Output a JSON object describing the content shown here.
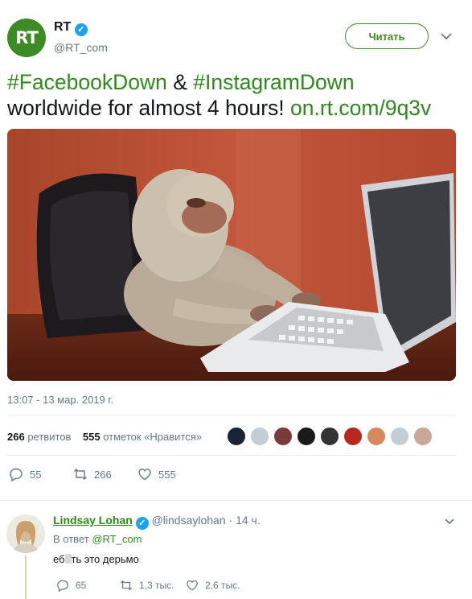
{
  "tweet": {
    "author_name": "RT",
    "author_handle": "@RT_com",
    "avatar_text": "RT",
    "follow_label": "Читать",
    "hashtag1": "#FacebookDown",
    "amp": " & ",
    "hashtag2": "#InstagramDown",
    "text_line2": "worldwide for almost 4 hours! ",
    "link": "on.rt.com/9q3v",
    "timestamp": "13:07 - 13 мар. 2019 г.",
    "retweets_count": "266",
    "retweets_label": "ретвитов",
    "likes_count": "555",
    "likes_label": "отметок «Нравится»",
    "replies_action": "55",
    "retweets_action": "266",
    "likes_action": "555"
  },
  "reply": {
    "author_name": "Lindsay Lohan",
    "author_handle": "@lindsaylohan",
    "time": "· 14 ч.",
    "reply_prefix": "В ответ ",
    "reply_to": "@RT_com",
    "text": "еб",
    "text_rest": "ть это дерьмо",
    "replies": "65",
    "retweets": "1,3 тыс.",
    "likes": "2,6 тыс."
  },
  "colors": {
    "brand_green": "#3d8b24",
    "link_green": "#2f8a1c",
    "muted": "#657786",
    "verified_blue": "#1da1f2"
  },
  "icons": [
    "verified-icon",
    "chevron-down-icon",
    "reply-icon",
    "retweet-icon",
    "like-icon"
  ]
}
